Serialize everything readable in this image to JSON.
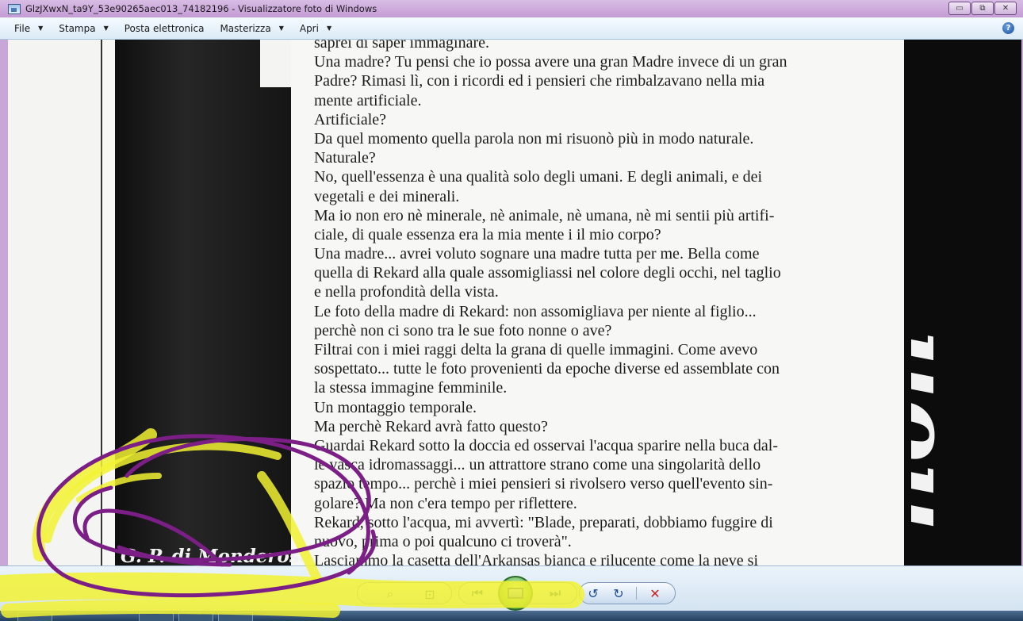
{
  "window": {
    "title": "GlzJXwxN_ta9Y_53e90265aec013_74182196 - Visualizzatore foto di Windows",
    "minimize": "▭",
    "maximize": "⧉",
    "close": "✕"
  },
  "menu": {
    "items": [
      {
        "label": "File"
      },
      {
        "label": "Stampa"
      },
      {
        "label": "Posta elettronica"
      },
      {
        "label": "Masterizza"
      },
      {
        "label": "Apri"
      }
    ],
    "help": "?"
  },
  "photo": {
    "text_lines": [
      "saprei di saper immaginare.",
      "Una madre? Tu pensi che io possa avere una gran Madre invece di un gran",
      "Padre? Rimasi lì, con i ricordi ed i pensieri che rimbalzavano nella mia",
      "mente artificiale.",
      "Artificiale?",
      "Da quel momento quella parola non mi risuonò più in modo naturale.",
      "Naturale?",
      "No, quell'essenza è una qualità solo degli umani. E degli animali, e dei",
      "vegetali e dei minerali.",
      "Ma io non ero nè minerale, nè animale, nè umana, nè mi sentii più artifi-",
      "ciale, di quale essenza era la mia mente i il mio corpo?",
      "Una madre...  avrei voluto sognare una madre tutta per me. Bella come",
      "quella di Rekard alla quale assomigliassi nel colore degli occhi, nel taglio",
      "e nella profondità della vista.",
      "Le foto della madre di Rekard: non assomigliava per niente al figlio...",
      "perchè non ci sono tra le sue foto nonne o ave?",
      "Filtrai con i miei raggi delta la grana di quelle immagini. Come avevo",
      "sospettato... tutte le foto provenienti da epoche diverse ed assemblate con",
      "la stessa immagine femminile.",
      "Un montaggio temporale.",
      "Ma perchè Rekard avrà fatto questo?",
      "Guardai Rekard sotto la doccia ed osservai l'acqua sparire nella buca dal-",
      "le vasca idromassaggi... un attrattore strano come una singolarità dello",
      "spazio tempo... perchè i miei pensieri si rivolsero verso quell'evento sin-",
      "golare? Ma non c'era tempo per riflettere.",
      "Rekard, sotto l'acqua, mi avvertì: \"Blade, preparati, dobbiamo fuggire di",
      "nuovo, prima o poi qualcuno ci troverà\".",
      "Lasciammo la casetta dell'Arkansas bianca e rilucente come la neve si"
    ],
    "author_caption": "G. P. di Monderose",
    "right_lettering": "non"
  },
  "toolbar": {
    "prev_label": "⏮",
    "next_label": "⏭",
    "rotate_ccw": "↺",
    "rotate_cw": "↻",
    "delete": "✕"
  },
  "colors": {
    "title_bar": "#c9a6d8",
    "toolbar": "#dbe8f4",
    "annotation_purple": "#7b1f86",
    "annotation_yellow": "#f2f233"
  }
}
